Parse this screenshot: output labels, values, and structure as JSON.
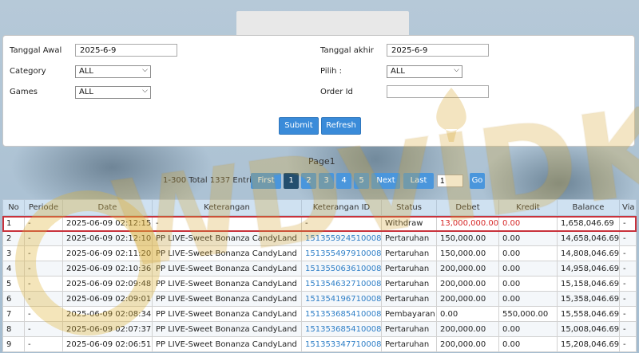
{
  "form": {
    "tanggal_awal_label": "Tanggal Awal",
    "tanggal_awal_value": "2025-6-9",
    "tanggal_akhir_label": "Tanggal akhir",
    "tanggal_akhir_value": "2025-6-9",
    "category_label": "Category",
    "category_value": "ALL",
    "pilih_label": "Pilih :",
    "pilih_value": "ALL",
    "games_label": "Games",
    "games_value": "ALL",
    "order_id_label": "Order Id",
    "order_id_value": "",
    "submit_label": "Submit",
    "refresh_label": "Refresh"
  },
  "pagination": {
    "page_label": "Page1",
    "entri_text": "1-300 Total 1337 Entri",
    "first_label": "First",
    "pages": [
      "1",
      "2",
      "3",
      "4",
      "5"
    ],
    "active_page": "1",
    "next_label": "Next",
    "last_label": "Last",
    "goto_value": "1",
    "go_label": "Go"
  },
  "table": {
    "headers": [
      "No",
      "Periode",
      "Date",
      "Keterangan",
      "Keterangan ID",
      "Status",
      "Debet",
      "Kredit",
      "Balance",
      "Via"
    ],
    "rows": [
      [
        "1",
        "-",
        "2025-06-09 02:12:15",
        "-",
        "-",
        "Withdraw",
        "13,000,000.00",
        "0.00",
        "1,658,046.69",
        "-"
      ],
      [
        "2",
        "-",
        "2025-06-09 02:12:10",
        "PP LIVE-Sweet Bonanza CandyLand",
        "151355924510008",
        "Pertaruhan",
        "150,000.00",
        "0.00",
        "14,658,046.69",
        "-"
      ],
      [
        "3",
        "-",
        "2025-06-09 02:11:20",
        "PP LIVE-Sweet Bonanza CandyLand",
        "151355497910008",
        "Pertaruhan",
        "150,000.00",
        "0.00",
        "14,808,046.69",
        "-"
      ],
      [
        "4",
        "-",
        "2025-06-09 02:10:36",
        "PP LIVE-Sweet Bonanza CandyLand",
        "151355063610008",
        "Pertaruhan",
        "200,000.00",
        "0.00",
        "14,958,046.69",
        "-"
      ],
      [
        "5",
        "-",
        "2025-06-09 02:09:48",
        "PP LIVE-Sweet Bonanza CandyLand",
        "151354632710008",
        "Pertaruhan",
        "200,000.00",
        "0.00",
        "15,158,046.69",
        "-"
      ],
      [
        "6",
        "-",
        "2025-06-09 02:09:01",
        "PP LIVE-Sweet Bonanza CandyLand",
        "151354196710008",
        "Pertaruhan",
        "200,000.00",
        "0.00",
        "15,358,046.69",
        "-"
      ],
      [
        "7",
        "-",
        "2025-06-09 02:08:34",
        "PP LIVE-Sweet Bonanza CandyLand",
        "151353685410008",
        "Pembayaran",
        "0.00",
        "550,000.00",
        "15,558,046.69",
        "-"
      ],
      [
        "8",
        "-",
        "2025-06-09 02:07:37",
        "PP LIVE-Sweet Bonanza CandyLand",
        "151353685410008",
        "Pertaruhan",
        "200,000.00",
        "0.00",
        "15,008,046.69",
        "-"
      ],
      [
        "9",
        "-",
        "2025-06-09 02:06:51",
        "PP LIVE-Sweet Bonanza CandyLand",
        "151353347710008",
        "Pertaruhan",
        "200,000.00",
        "0.00",
        "15,208,046.69",
        "-"
      ]
    ]
  },
  "watermark": {
    "text": "WDVIDK"
  },
  "colors": {
    "button_blue": "#3a8bd9",
    "active_page": "#234e6e",
    "link_blue": "#2f7fc7",
    "debet_red": "#d62828",
    "highlight_border": "#c8323c",
    "header_bg": "#cfe1f1"
  }
}
